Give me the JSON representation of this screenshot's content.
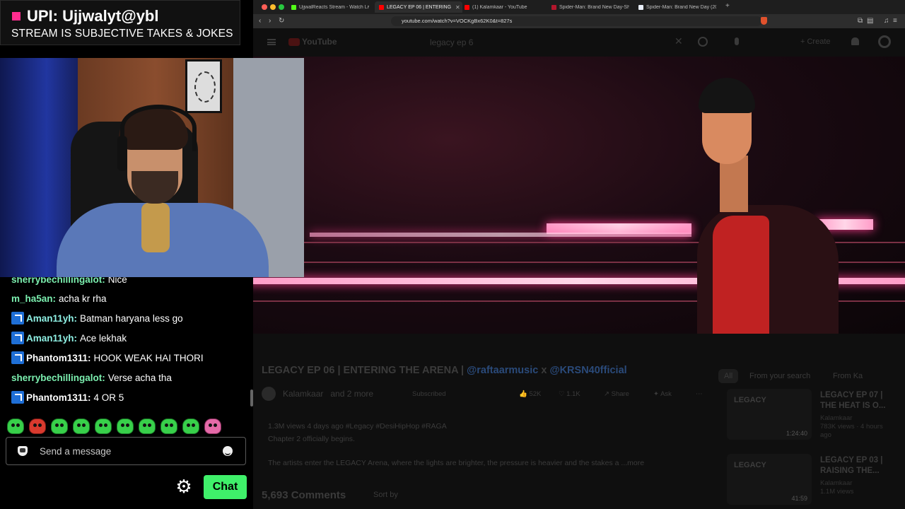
{
  "overlay": {
    "upi_title": "UPI: Ujjwalyt@ybl",
    "subtitle": "STREAM IS SUBJECTIVE TAKES & JOKES"
  },
  "chat": {
    "messages": [
      {
        "user": "sherrybechillingalot:",
        "text": "Nice",
        "badge": false
      },
      {
        "user": "m_ha5an:",
        "text": "acha kr rha",
        "badge": false
      },
      {
        "user": "Aman11yh:",
        "text": "Batman haryana less go",
        "badge": true
      },
      {
        "user": "Aman11yh:",
        "text": "Ace lekhak",
        "badge": true
      },
      {
        "user": "Phantom1311:",
        "text": "HOOK WEAK HAI THORI",
        "badge": true
      },
      {
        "user": "sherrybechillingalot:",
        "text": "Verse acha tha",
        "badge": false
      },
      {
        "user": "Phantom1311:",
        "text": "4 OR 5",
        "badge": true
      }
    ],
    "input_placeholder": "Send a message",
    "chat_button": "Chat",
    "accent_color": "#3ff06a"
  },
  "browser": {
    "tabs": [
      {
        "label": "UjjwalReacts Stream - Watch Live",
        "icon": "kick-icon"
      },
      {
        "label": "LEGACY EP 06 | ENTERING",
        "icon": "youtube-icon"
      },
      {
        "label": "(1) Kalamkaar - YouTube",
        "icon": "youtube-icon"
      },
      {
        "label": "Spider-Man: Brand New Day-Show",
        "icon": "spiderman-icon"
      },
      {
        "label": "Spider-Man: Brand New Day (2026",
        "icon": "page-icon"
      }
    ],
    "url": "youtube.com/watch?v=VOCKgBx62K0&t=827s"
  },
  "youtube": {
    "logo": "YouTube",
    "search_query": "legacy ep 6",
    "create_label": "Create",
    "video_title_plain": "LEGACY EP 06 | ENTERING THE ARENA | ",
    "video_title_link1": "@raftaarmusic",
    "video_title_x": " x ",
    "video_title_link2": "@KRSN40fficial",
    "channel": "Kalamkaar",
    "channel_suffix": "and 2 more",
    "subscribed": "Subscribed",
    "likes": "52K",
    "comments_short": "1.1K",
    "share": "Share",
    "ask": "Ask",
    "desc_meta": "1.3M views  4 days ago  #Legacy #DesiHipHop #RAGA",
    "desc_line2": "Chapter 2 officially begins.",
    "desc_line3": "The artists enter the LEGACY Arena, where the lights are brighter, the pressure is heavier and the stakes a",
    "desc_more": "...more",
    "comments_count": "5,693 Comments",
    "sort_by": "Sort by",
    "chips": [
      "All",
      "From your search",
      "From Ka"
    ],
    "recommendations": [
      {
        "title": "LEGACY EP 07 | THE HEAT IS O...",
        "channel": "Kalamkaar",
        "meta": "783K views · 4 hours ago",
        "duration": "1:24:40",
        "thumb_label": "LEGACY"
      },
      {
        "title": "LEGACY EP 03 | RAISING THE...",
        "channel": "Kalamkaar",
        "meta": "1.1M views",
        "duration": "41:59",
        "thumb_label": "LEGACY"
      }
    ]
  }
}
